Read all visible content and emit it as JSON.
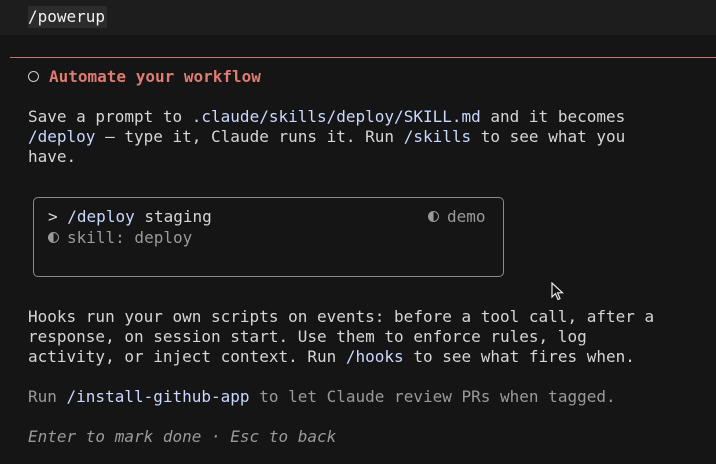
{
  "input": {
    "command": "/powerup"
  },
  "card": {
    "title": "Automate your workflow",
    "para1": {
      "line1_pre": "Save a prompt to ",
      "line1_path": ".claude/skills/deploy/SKILL.md",
      "line1_post": " and it becomes",
      "line2_cmd": "/deploy",
      "line2_mid": " — type it, Claude runs it. Run ",
      "line2_cmd2": "/skills",
      "line2_post": " to see what you",
      "line3": "have."
    },
    "demo": {
      "prompt_symbol": ">",
      "command": "/deploy",
      "arg": " staging",
      "badge": "demo",
      "skill_text": "skill: deploy"
    },
    "para2": {
      "line1": "Hooks run your own scripts on events: before a tool call, after a",
      "line2": "response, on session start. Use them to enforce rules, log",
      "line3_pre": "activity, or inject context. Run ",
      "line3_cmd": "/hooks",
      "line3_post": " to see what fires when."
    },
    "para3": {
      "pre": "Run ",
      "cmd": "/install-github-app",
      "post": " to let Claude review PRs when tagged."
    },
    "footer": "Enter to mark done · Esc to back"
  },
  "colors": {
    "accent": "#e07b72",
    "command": "#c9d8ff",
    "divider": "#c2736c"
  },
  "icons": [
    "status-circle-icon",
    "half-circle-icon",
    "mouse-cursor-icon"
  ]
}
